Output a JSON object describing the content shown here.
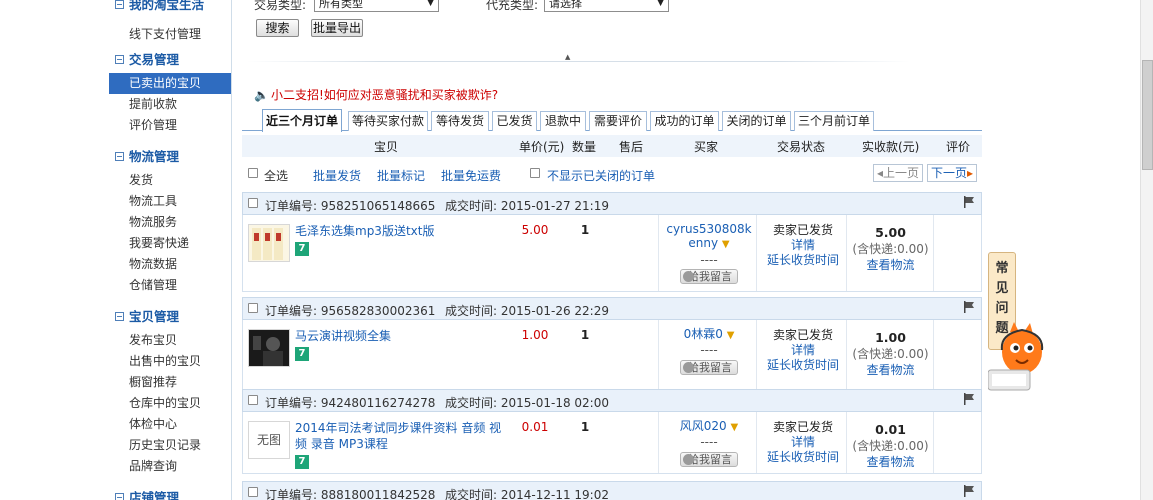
{
  "sidebar": {
    "sections": [
      {
        "title": "我的淘宝生活",
        "items": [
          {
            "label": "线下支付管理",
            "active": false
          }
        ]
      },
      {
        "title": "交易管理",
        "items": [
          {
            "label": "已卖出的宝贝",
            "active": true
          },
          {
            "label": "提前收款",
            "active": false
          },
          {
            "label": "评价管理",
            "active": false
          }
        ]
      },
      {
        "title": "物流管理",
        "items": [
          {
            "label": "发货"
          },
          {
            "label": "物流工具"
          },
          {
            "label": "物流服务"
          },
          {
            "label": "我要寄快递"
          },
          {
            "label": "物流数据"
          },
          {
            "label": "仓储管理"
          }
        ]
      },
      {
        "title": "宝贝管理",
        "items": [
          {
            "label": "发布宝贝"
          },
          {
            "label": "出售中的宝贝"
          },
          {
            "label": "橱窗推荐"
          },
          {
            "label": "仓库中的宝贝"
          },
          {
            "label": "体检中心"
          },
          {
            "label": "历史宝贝记录"
          },
          {
            "label": "品牌查询"
          }
        ]
      },
      {
        "title": "店铺管理",
        "items": []
      }
    ]
  },
  "filters": {
    "trade_type_label": "交易类型:",
    "trade_type_value": "所有类型",
    "pay_type_label": "代充类型:",
    "pay_type_value": "请选择",
    "search_btn": "搜索",
    "export_btn": "批量导出"
  },
  "notice": {
    "prefix": "小二支招!",
    "text": "如何应对恶意骚扰和买家被欺诈?"
  },
  "tabs": [
    "近三个月订单",
    "等待买家付款",
    "等待发货",
    "已发货",
    "退款中",
    "需要评价",
    "成功的订单",
    "关闭的订单",
    "三个月前订单"
  ],
  "table_headers": [
    "宝贝",
    "单价(元)",
    "数量",
    "售后",
    "买家",
    "交易状态",
    "实收款(元)",
    "评价"
  ],
  "toolbar": {
    "select_all": "全选",
    "batch_ship": "批量发货",
    "batch_mark": "批量标记",
    "batch_free_ship": "批量免运费",
    "hide_closed": "不显示已关闭的订单",
    "prev_page": "上一页",
    "next_page": "下一页"
  },
  "orders": [
    {
      "order_no": "订单编号: 958251065148665",
      "time": "成交时间: 2015-01-27 21:19",
      "title": "毛泽东选集mp3版送txt版",
      "price": "5.00",
      "qty": "1",
      "buyer": "cyrus530808kenny",
      "dashes": "----",
      "msg_btn": "给我留言",
      "status": "卖家已发货",
      "detail": "详情",
      "extend": "延长收货时间",
      "amount": "5.00",
      "shipping": "(含快递:0.00)",
      "logistics": "查看物流",
      "thumb_label": ""
    },
    {
      "order_no": "订单编号: 956582830002361",
      "time": "成交时间: 2015-01-26 22:29",
      "title": "马云演讲视频全集",
      "price": "1.00",
      "qty": "1",
      "buyer": "0林霖0",
      "dashes": "----",
      "msg_btn": "给我留言",
      "status": "卖家已发货",
      "detail": "详情",
      "extend": "延长收货时间",
      "amount": "1.00",
      "shipping": "(含快递:0.00)",
      "logistics": "查看物流",
      "thumb_label": ""
    },
    {
      "order_no": "订单编号: 942480116274278",
      "time": "成交时间: 2015-01-18 02:00",
      "title": "2014年司法考试同步课件资料 音频 视频 录音 MP3课程",
      "price": "0.01",
      "qty": "1",
      "buyer": "风风020",
      "dashes": "----",
      "msg_btn": "给我留言",
      "status": "卖家已发货",
      "detail": "详情",
      "extend": "延长收货时间",
      "amount": "0.01",
      "shipping": "(含快递:0.00)",
      "logistics": "查看物流",
      "thumb_label": "无图"
    },
    {
      "order_no": "订单编号: 888180011842528",
      "time": "成交时间: 2014-12-11 19:02"
    }
  ],
  "faq": {
    "label": [
      "常",
      "见",
      "问",
      "题"
    ]
  },
  "colors": {
    "link": "#1a5fb4",
    "price": "#cc0000",
    "active_nav": "#2f6cc0",
    "badge": "#1ea578"
  }
}
